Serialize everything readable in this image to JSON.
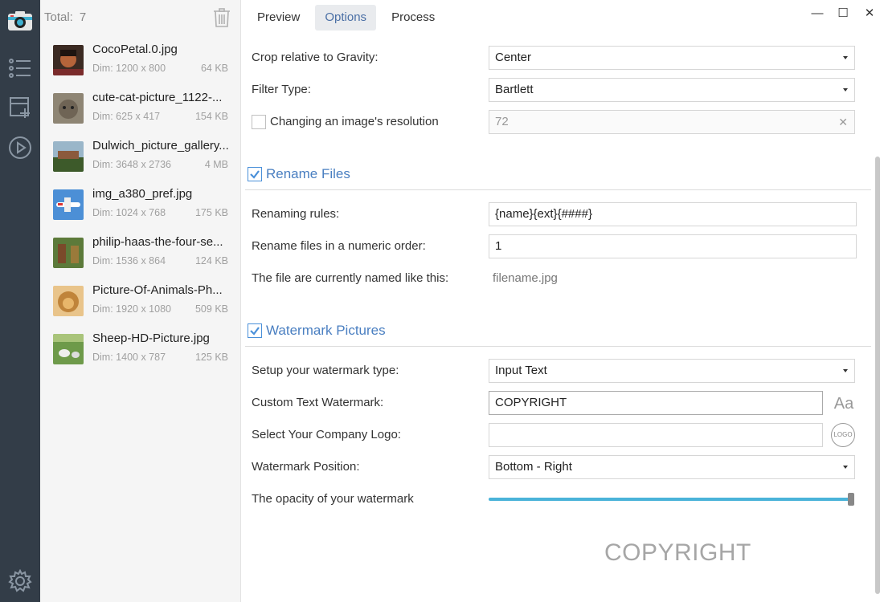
{
  "rail": {
    "items": [
      "camera-app-icon",
      "list-icon",
      "add-panel-icon",
      "play-icon",
      "settings-icon"
    ]
  },
  "filelist": {
    "total_label": "Total:",
    "total_count": "7",
    "files": [
      {
        "name": "CocoPetal.0.jpg",
        "dim": "Dim: 1200 x 800",
        "size": "64 KB",
        "thumb": "#7a3b2e"
      },
      {
        "name": "cute-cat-picture_1122-...",
        "dim": "Dim: 625 x 417",
        "size": "154 KB",
        "thumb": "#7d7266"
      },
      {
        "name": "Dulwich_picture_gallery...",
        "dim": "Dim: 3648 x 2736",
        "size": "4 MB",
        "thumb": "#5b6e46"
      },
      {
        "name": "img_a380_pref.jpg",
        "dim": "Dim: 1024 x 768",
        "size": "175 KB",
        "thumb": "#3a7fc8"
      },
      {
        "name": "philip-haas-the-four-se...",
        "dim": "Dim: 1536 x 864",
        "size": "124 KB",
        "thumb": "#6b5a3a"
      },
      {
        "name": "Picture-Of-Animals-Ph...",
        "dim": "Dim: 1920 x 1080",
        "size": "509 KB",
        "thumb": "#c08a3e"
      },
      {
        "name": "Sheep-HD-Picture.jpg",
        "dim": "Dim: 1400 x 787",
        "size": "125 KB",
        "thumb": "#6f9a52"
      }
    ]
  },
  "tabs": [
    "Preview",
    "Options",
    "Process"
  ],
  "active_tab": "Options",
  "window": {
    "minimize": "—",
    "maximize": "☐",
    "close": "✕"
  },
  "options": {
    "crop_label": "Crop relative to Gravity:",
    "crop_value": "Center",
    "filter_label": "Filter Type:",
    "filter_value": "Bartlett",
    "resolution_label": "Changing an image's resolution",
    "resolution_value": "72",
    "rename_section": "Rename Files",
    "renaming_rules_label": "Renaming rules:",
    "renaming_rules_value": "{name}{ext}{####}",
    "numeric_order_label": "Rename files in a numeric order:",
    "numeric_order_value": "1",
    "current_name_label": "The file are currently named like this:",
    "current_name_value": "filename.jpg",
    "watermark_section": "Watermark Pictures",
    "wm_type_label": "Setup your watermark type:",
    "wm_type_value": "Input Text",
    "wm_text_label": "Custom Text Watermark:",
    "wm_text_value": "COPYRIGHT",
    "font_button": "Aa",
    "logo_label": "Select Your Company Logo:",
    "logo_value": "",
    "logo_button": "LOGO",
    "position_label": "Watermark Position:",
    "position_value": "Bottom - Right",
    "opacity_label": "The opacity of your watermark",
    "opacity_value": 1.0,
    "preview_text": "COPYRIGHT"
  },
  "colors": {
    "accent": "#4a7fc1",
    "rail": "#333d48",
    "slider": "#4ab3d9"
  }
}
